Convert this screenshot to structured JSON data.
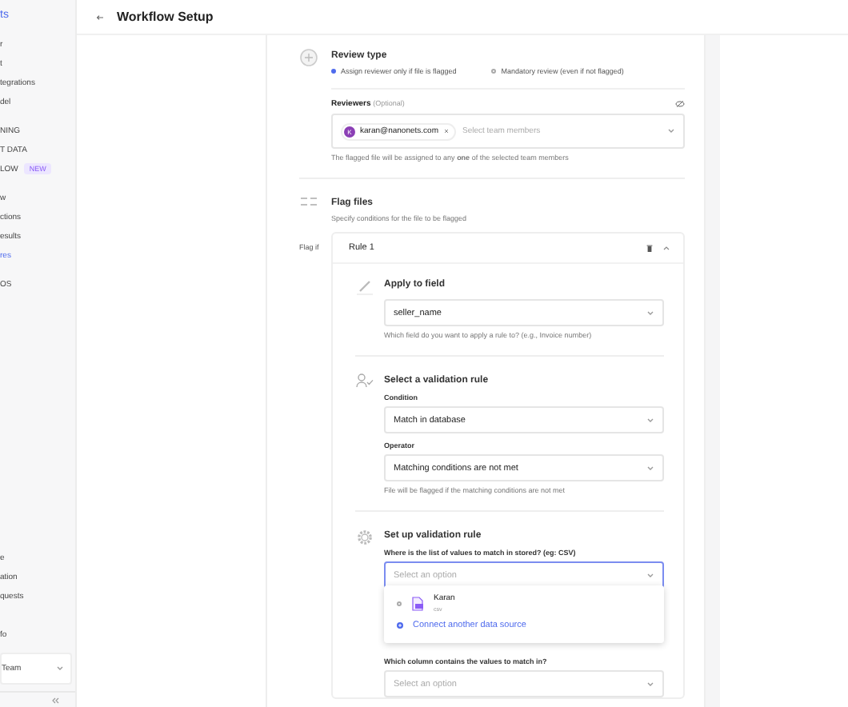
{
  "sidebar": {
    "brand": "ts",
    "groups": [
      [
        {
          "label": "r",
          "selected": false
        },
        {
          "label": "t",
          "selected": false
        },
        {
          "label": "tegrations",
          "selected": false
        },
        {
          "label": "del",
          "selected": false
        }
      ],
      [
        {
          "label": "NING",
          "selected": false
        },
        {
          "label": "T DATA",
          "selected": false
        },
        {
          "label": "LOW",
          "selected": false,
          "badge": "NEW"
        }
      ],
      [
        {
          "label": "w",
          "selected": false
        },
        {
          "label": "ctions",
          "selected": false
        },
        {
          "label": "esults",
          "selected": false
        },
        {
          "label": "res",
          "selected": true
        }
      ],
      [
        {
          "label": "OS",
          "selected": false
        }
      ]
    ],
    "bottom": [
      {
        "label": "e"
      },
      {
        "label": "ation"
      },
      {
        "label": "quests"
      },
      {
        "label": "fo"
      }
    ],
    "team": "Team"
  },
  "header": {
    "title": "Workflow Setup"
  },
  "review": {
    "title": "Review type",
    "options": [
      {
        "label": "Assign reviewer only if file is flagged",
        "selected": true
      },
      {
        "label": "Mandatory review (even if not flagged)",
        "selected": false
      }
    ],
    "reviewers_label": "Reviewers",
    "reviewers_note": "(Optional)",
    "chips": [
      {
        "initial": "K",
        "email": "karan@nanonets.com"
      }
    ],
    "placeholder": "Select team members",
    "help": "The flagged file will be assigned to any **one** of the selected team members"
  },
  "flag": {
    "title": "Flag files",
    "subtitle": "Specify conditions for the file to be flagged",
    "flag_if": "Flag if",
    "rule": {
      "title": "Rule 1",
      "expanded": true,
      "apply": {
        "title": "Apply to field",
        "value": "seller_name",
        "help": "Which field do you want to apply a rule to? (e.g., Invoice number)"
      },
      "validation": {
        "title": "Select a validation rule",
        "fields": [
          {
            "label": "Condition",
            "value": "Match in database"
          },
          {
            "label": "Operator",
            "value": "Matching conditions are not met",
            "help": "File will be flagged if the matching conditions are not met"
          }
        ]
      },
      "setup": {
        "title": "Set up validation rule",
        "source_label": "Where is the list of values to match in stored? (eg: CSV)",
        "source_placeholder": "Select an option",
        "menu": [
          {
            "kind": "source",
            "name": "Karan",
            "type": "csv",
            "selected": false
          },
          {
            "kind": "connect",
            "label": "Connect another data source"
          }
        ],
        "column_label": "Which column contains the values to match in?",
        "column_placeholder": "Select an option"
      }
    }
  }
}
